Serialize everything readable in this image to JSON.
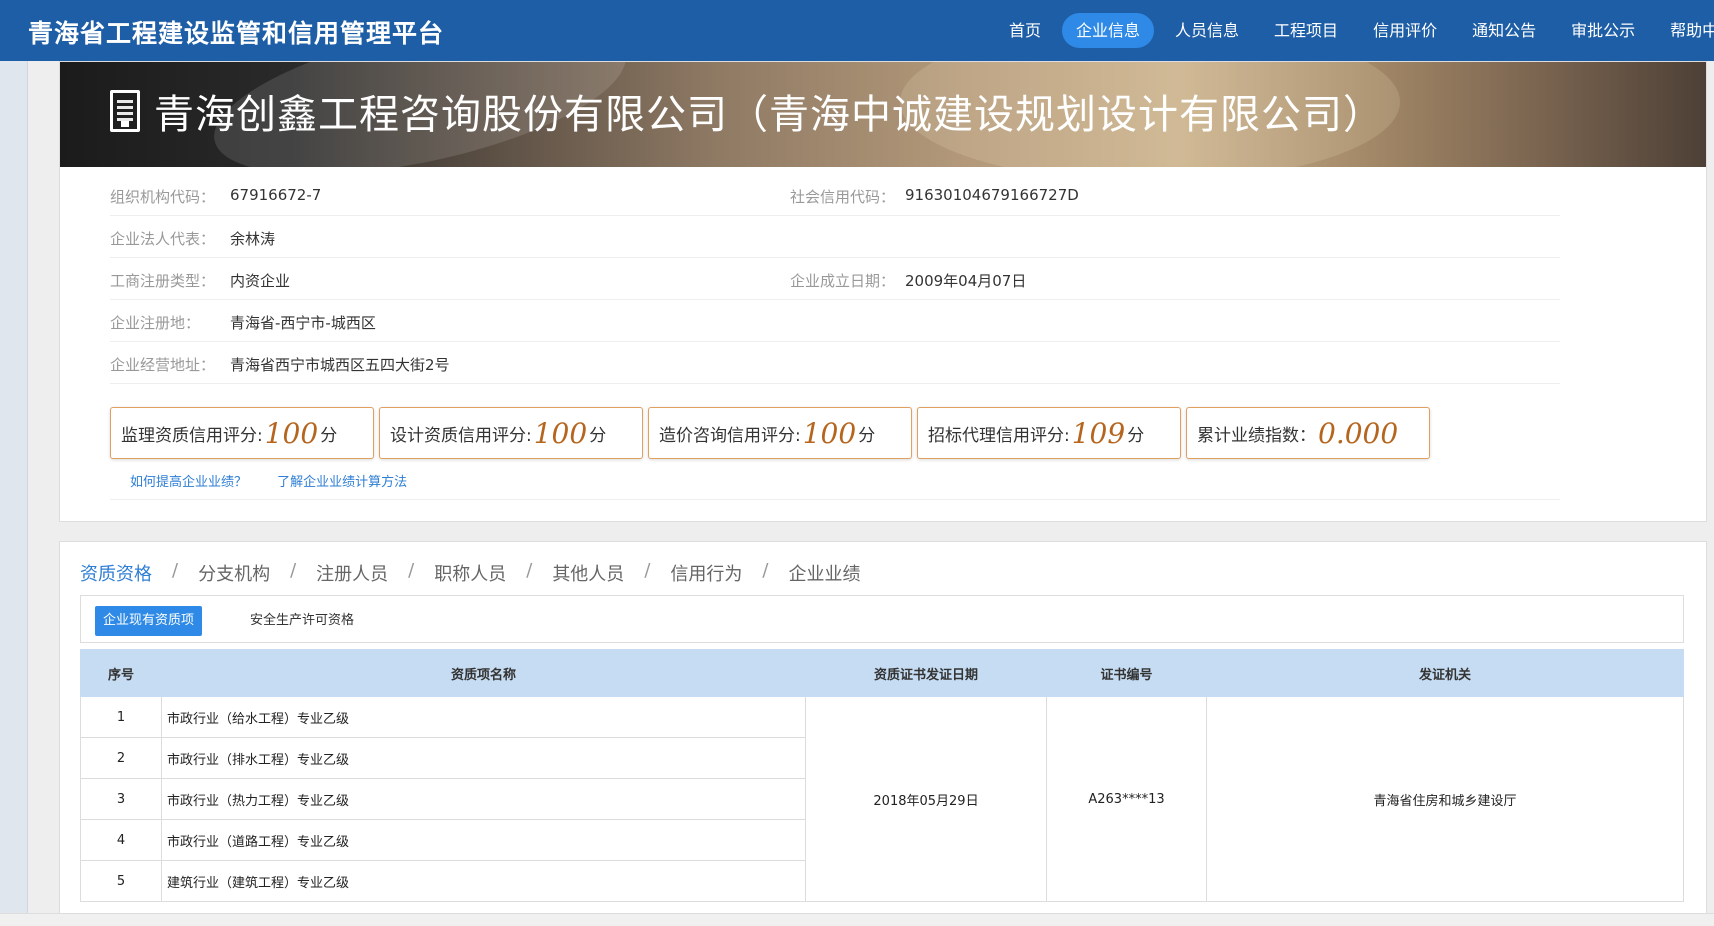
{
  "header": {
    "site_title": "青海省工程建设监管和信用管理平台",
    "nav": [
      "首页",
      "企业信息",
      "人员信息",
      "工程项目",
      "信用评价",
      "通知公告",
      "审批公示",
      "帮助中心"
    ],
    "active_nav": "企业信息"
  },
  "company": {
    "name": "青海创鑫工程咨询股份有限公司（青海中诚建设规划设计有限公司）",
    "org_code_label": "组织机构代码：",
    "org_code": "67916672-7",
    "credit_code_label": "社会信用代码：",
    "credit_code": "91630104679166727D",
    "legal_rep_label": "企业法人代表：",
    "legal_rep": "余林涛",
    "reg_type_label": "工商注册类型：",
    "reg_type": "内资企业",
    "found_date_label": "企业成立日期：",
    "found_date": "2009年04月07日",
    "reg_place_label": "企业注册地：",
    "reg_place": "青海省-西宁市-城西区",
    "address_label": "企业经营地址：",
    "address": "青海省西宁市城西区五四大街2号"
  },
  "scores": [
    {
      "label": "监理资质信用评分:",
      "value": "100",
      "unit": "分"
    },
    {
      "label": "设计资质信用评分:",
      "value": "100",
      "unit": "分"
    },
    {
      "label": "造价咨询信用评分:",
      "value": "100",
      "unit": "分"
    },
    {
      "label": "招标代理信用评分:",
      "value": "109",
      "unit": "分"
    },
    {
      "label": "累计业绩指数：",
      "value": "0.000",
      "unit": ""
    }
  ],
  "links": {
    "improve": "如何提高企业业绩？",
    "method": "了解企业业绩计算方法"
  },
  "tabs": [
    "资质资格",
    "分支机构",
    "注册人员",
    "职称人员",
    "其他人员",
    "信用行为",
    "企业业绩"
  ],
  "subtabs": [
    "企业现有资质项",
    "安全生产许可资格"
  ],
  "table": {
    "headers": [
      "序号",
      "资质项名称",
      "资质证书发证日期",
      "证书编号",
      "发证机关"
    ],
    "rows": [
      {
        "no": "1",
        "name": "市政行业（给水工程）专业乙级"
      },
      {
        "no": "2",
        "name": "市政行业（排水工程）专业乙级"
      },
      {
        "no": "3",
        "name": "市政行业（热力工程）专业乙级"
      },
      {
        "no": "4",
        "name": "市政行业（道路工程）专业乙级"
      },
      {
        "no": "5",
        "name": "建筑行业（建筑工程）专业乙级"
      }
    ],
    "issue_date": "2018年05月29日",
    "cert_no": "A263****13",
    "issuer": "青海省住房和城乡建设厅"
  },
  "colors": {
    "header_bg": "#1e5ea6",
    "active_nav_bg": "#2e8ae6",
    "link": "#2e7ed4",
    "score_value": "#b5651d",
    "table_header_bg": "#c6dcf2"
  }
}
